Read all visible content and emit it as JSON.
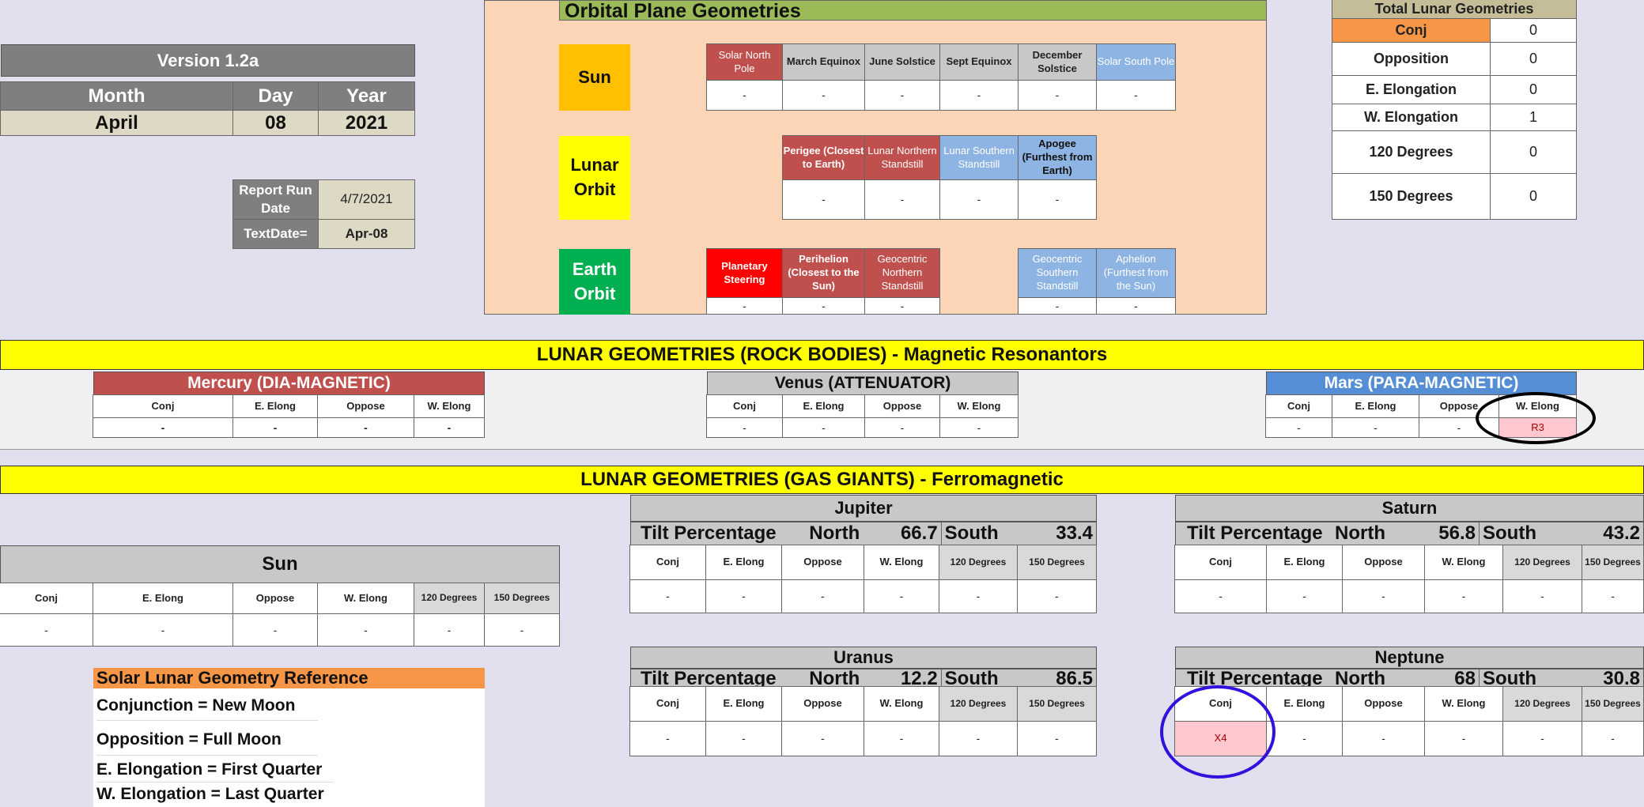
{
  "version": {
    "title": "Version 1.2a",
    "headers": [
      "Month",
      "Day",
      "Year"
    ],
    "values": [
      "April",
      "08",
      "2021"
    ]
  },
  "report": {
    "run_date_label": "Report Run Date",
    "run_date_value": "4/7/2021",
    "textdate_label": "TextDate=",
    "textdate_value": "Apr-08"
  },
  "orbital": {
    "title": "Orbital Plane Geometries",
    "sun_label": "Sun",
    "sun_headers": [
      "Solar North Pole",
      "March Equinox",
      "June Solstice",
      "Sept Equinox",
      "December Solstice",
      "Solar South Pole"
    ],
    "sun_values": [
      "-",
      "-",
      "-",
      "-",
      "-",
      "-"
    ],
    "lunar_label": "Lunar Orbit",
    "lunar_headers": [
      "Perigee (Closest to Earth)",
      "Lunar Northern Standstill",
      "Lunar Southern Standstill",
      "Apogee (Furthest from Earth)"
    ],
    "lunar_values": [
      "-",
      "-",
      "-",
      "-"
    ],
    "earth_label": "Earth Orbit",
    "earth_headers_left": [
      "Planetary Steering",
      "Perihelion (Closest to the Sun)",
      "Geocentric Northern Standstill"
    ],
    "earth_headers_right": [
      "Geocentric Southern Standstill",
      "Aphelion (Furthest from the Sun)"
    ],
    "earth_values_left": [
      "-",
      "-",
      "-"
    ],
    "earth_values_right": [
      "-",
      "-"
    ]
  },
  "totals": {
    "title": "Total Lunar Geometries",
    "rows": [
      {
        "label": "Conj",
        "value": "0"
      },
      {
        "label": "Opposition",
        "value": "0"
      },
      {
        "label": "E. Elongation",
        "value": "0"
      },
      {
        "label": "W. Elongation",
        "value": "1"
      },
      {
        "label": "120 Degrees",
        "value": "0"
      },
      {
        "label": "150 Degrees",
        "value": "0"
      }
    ]
  },
  "rock": {
    "title": "LUNAR GEOMETRIES (ROCK BODIES) - Magnetic Resonantors",
    "col_headers": [
      "Conj",
      "E. Elong",
      "Oppose",
      "W. Elong"
    ],
    "mercury": {
      "name": "Mercury (DIA-MAGNETIC)",
      "values": [
        "-",
        "-",
        "-",
        "-"
      ]
    },
    "venus": {
      "name": "Venus (ATTENUATOR)",
      "values": [
        "-",
        "-",
        "-",
        "-"
      ]
    },
    "mars": {
      "name": "Mars (PARA-MAGNETIC)",
      "values": [
        "-",
        "-",
        "-",
        "R3"
      ]
    }
  },
  "gas": {
    "title": "LUNAR GEOMETRIES (GAS GIANTS) - Ferromagnetic",
    "col_headers": [
      "Conj",
      "E. Elong",
      "Oppose",
      "W. Elong",
      "120 Degrees",
      "150 Degrees"
    ],
    "tilt_label": "Tilt Percentage",
    "north_label": "North",
    "south_label": "South",
    "sun": {
      "name": "Sun",
      "values": [
        "-",
        "-",
        "-",
        "-",
        "-",
        "-"
      ]
    },
    "jupiter": {
      "name": "Jupiter",
      "north": "66.7",
      "south": "33.4",
      "values": [
        "-",
        "-",
        "-",
        "-",
        "-",
        "-"
      ]
    },
    "saturn": {
      "name": "Saturn",
      "north": "56.8",
      "south": "43.2",
      "values": [
        "-",
        "-",
        "-",
        "-",
        "-",
        "-"
      ]
    },
    "uranus": {
      "name": "Uranus",
      "north": "12.2",
      "south": "86.5",
      "values": [
        "-",
        "-",
        "-",
        "-",
        "-",
        "-"
      ]
    },
    "neptune": {
      "name": "Neptune",
      "north": "68",
      "south": "30.8",
      "values": [
        "X4",
        "-",
        "-",
        "-",
        "-",
        "-"
      ]
    }
  },
  "reference": {
    "title": "Solar Lunar Geometry Reference",
    "lines": [
      "Conjunction = New Moon",
      "Opposition = Full Moon",
      "E. Elongation = First Quarter",
      "W. Elongation = Last Quarter"
    ]
  },
  "colors": {
    "header_gray": "#7f7f7f",
    "cream": "#ddd9c4",
    "peach": "#fbd5b5",
    "green_title": "#9bbb59",
    "sun_orange": "#ffc000",
    "lunar_yellow": "#ffff00",
    "earth_green": "#00b050",
    "red_header": "#c0504d",
    "blue_header": "#8db4e2",
    "bright_red": "#ff0000",
    "orange_ref": "#f79646",
    "highlight_pink": "#ffc7ce",
    "circle_black": "#000000",
    "circle_blue": "#3311dd"
  }
}
